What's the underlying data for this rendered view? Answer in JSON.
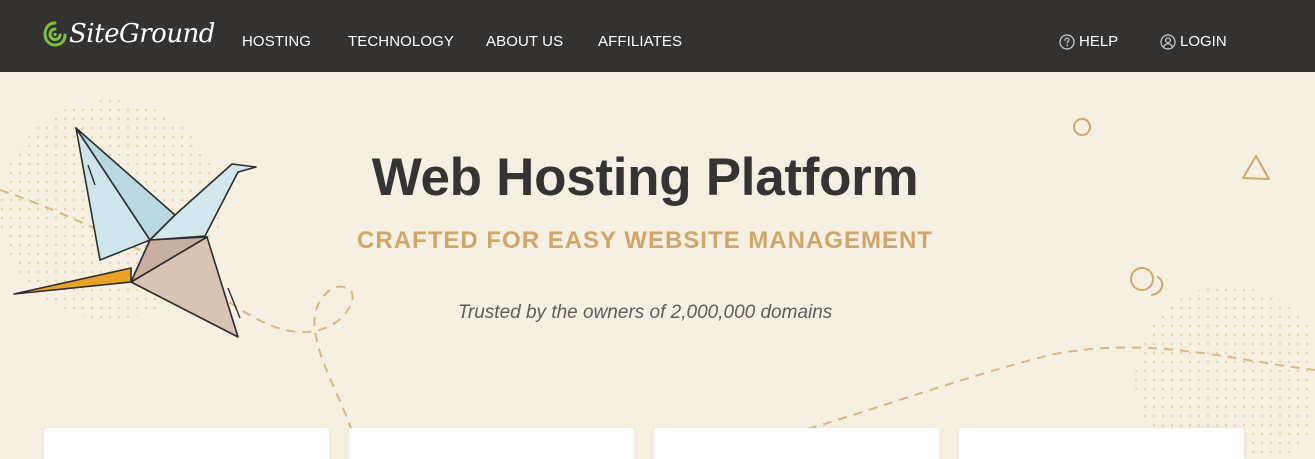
{
  "header": {
    "brand": "SiteGround",
    "nav": [
      "HOSTING",
      "TECHNOLOGY",
      "ABOUT US",
      "AFFILIATES"
    ],
    "help_label": "HELP",
    "login_label": "LOGIN"
  },
  "hero": {
    "title": "Web Hosting Platform",
    "subtitle": "CRAFTED FOR EASY WEBSITE MANAGEMENT",
    "trust": "Trusted by the owners of 2,000,000 domains"
  },
  "colors": {
    "header_bg": "#343230",
    "page_bg": "#f5f0e2",
    "accent_gold": "#d0a66a",
    "logo_green": "#7ac142"
  },
  "icons": [
    "siteground-logo-icon",
    "help-circle-icon",
    "user-circle-icon",
    "paper-crane-icon"
  ]
}
